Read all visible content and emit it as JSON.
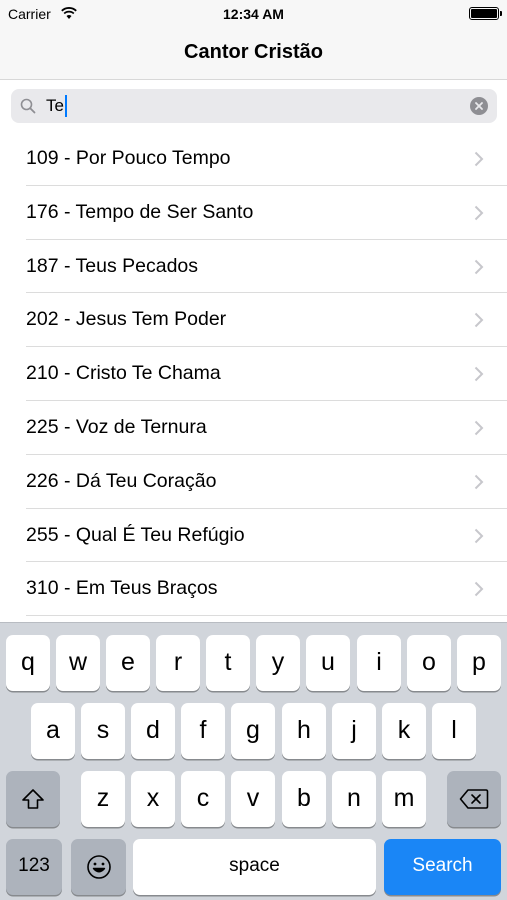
{
  "status_bar": {
    "carrier": "Carrier",
    "time": "12:34 AM"
  },
  "nav": {
    "title": "Cantor Cristão"
  },
  "search": {
    "value": "Te"
  },
  "list": {
    "items": [
      {
        "label": "109 - Por Pouco Tempo"
      },
      {
        "label": "176 - Tempo de Ser Santo"
      },
      {
        "label": "187 - Teus Pecados"
      },
      {
        "label": "202 - Jesus Tem Poder"
      },
      {
        "label": "210 - Cristo Te Chama"
      },
      {
        "label": "225 - Voz de Ternura"
      },
      {
        "label": "226 - Dá Teu Coração"
      },
      {
        "label": "255 - Qual É Teu Refúgio"
      },
      {
        "label": "310 - Em Teus Braços"
      }
    ]
  },
  "keyboard": {
    "row1": [
      "q",
      "w",
      "e",
      "r",
      "t",
      "y",
      "u",
      "i",
      "o",
      "p"
    ],
    "row2": [
      "a",
      "s",
      "d",
      "f",
      "g",
      "h",
      "j",
      "k",
      "l"
    ],
    "row3": [
      "z",
      "x",
      "c",
      "v",
      "b",
      "n",
      "m"
    ],
    "numbers_label": "123",
    "space_label": "space",
    "search_label": "Search",
    "accent_color": "#1a86f6"
  }
}
